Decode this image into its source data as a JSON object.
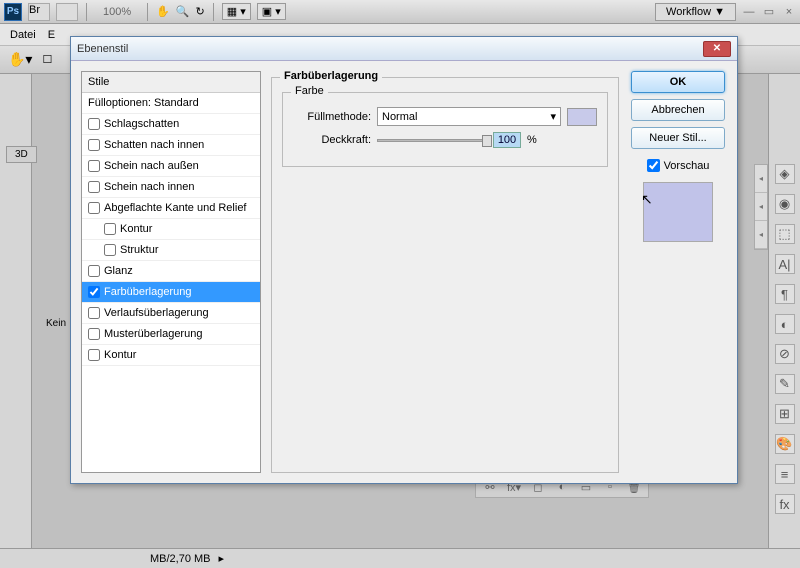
{
  "app": {
    "zoom": "100%",
    "workflow": "Workflow ▼",
    "menu": {
      "datei": "Datei"
    }
  },
  "workspace": {
    "tab3d": "3D",
    "canvas_label": "Kein",
    "status": "MB/2,70 MB"
  },
  "dialog": {
    "title": "Ebenenstil",
    "styles_header": "Stile",
    "items": [
      {
        "label": "Fülloptionen: Standard",
        "checked": null
      },
      {
        "label": "Schlagschatten",
        "checked": false
      },
      {
        "label": "Schatten nach innen",
        "checked": false
      },
      {
        "label": "Schein nach außen",
        "checked": false
      },
      {
        "label": "Schein nach innen",
        "checked": false
      },
      {
        "label": "Abgeflachte Kante und Relief",
        "checked": false
      },
      {
        "label": "Kontur",
        "checked": false,
        "indent": true
      },
      {
        "label": "Struktur",
        "checked": false,
        "indent": true
      },
      {
        "label": "Glanz",
        "checked": false
      },
      {
        "label": "Farbüberlagerung",
        "checked": true,
        "selected": true
      },
      {
        "label": "Verlaufsüberlagerung",
        "checked": false
      },
      {
        "label": "Musterüberlagerung",
        "checked": false
      },
      {
        "label": "Kontur",
        "checked": false
      }
    ],
    "settings": {
      "heading": "Farbüberlagerung",
      "color_group": "Farbe",
      "blend_label": "Füllmethode:",
      "blend_value": "Normal",
      "opacity_label": "Deckkraft:",
      "opacity_value": "100",
      "opacity_unit": "%",
      "swatch_color": "#c8caea"
    },
    "actions": {
      "ok": "OK",
      "cancel": "Abbrechen",
      "new_style": "Neuer Stil...",
      "preview": "Vorschau"
    }
  }
}
